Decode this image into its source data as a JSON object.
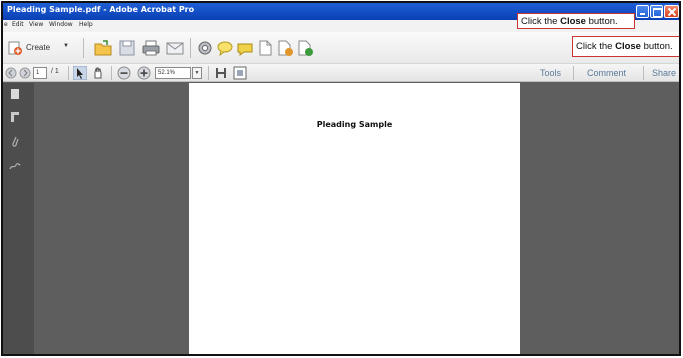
{
  "window": {
    "title": "Pleading Sample.pdf - Adobe Acrobat Pro"
  },
  "menu": {
    "items": [
      "e",
      "Edit",
      "View",
      "Window",
      "Help"
    ]
  },
  "toolbar": {
    "create_label": "Create",
    "icons": [
      "open-folder-icon",
      "save-icon",
      "print-icon",
      "email-icon",
      "settings-icon",
      "comment-bubble-icon",
      "highlight-icon",
      "document-icon",
      "document-export-icon",
      "document-share-icon"
    ]
  },
  "nav": {
    "page_current": "1",
    "page_total": "/ 1",
    "zoom": "52.1%"
  },
  "panels": {
    "tools": "Tools",
    "comment": "Comment",
    "share": "Share"
  },
  "document": {
    "heading": "Pleading Sample"
  },
  "callouts": {
    "text_before": "Click the ",
    "text_bold": "Close",
    "text_after": " button."
  },
  "colors": {
    "titlebar": "#0a3fb4",
    "close_button": "#d8401e",
    "callout_border": "#cc3333",
    "document_background": "#5e5e5e"
  }
}
